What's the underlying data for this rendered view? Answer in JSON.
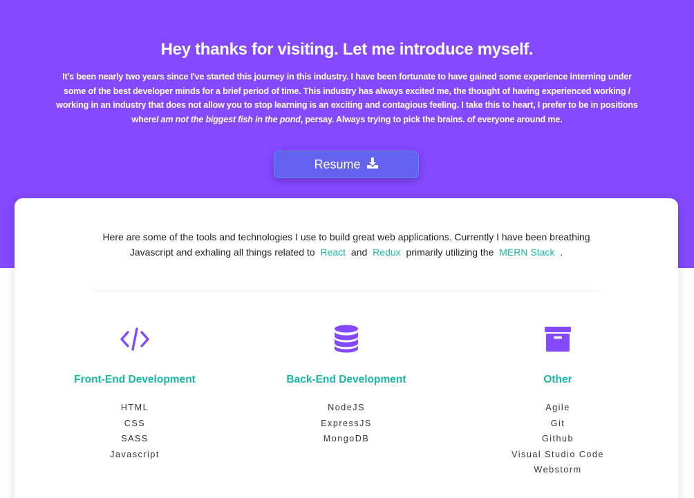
{
  "hero": {
    "title": "Hey thanks for visiting. Let me introduce myself.",
    "text_part1": "It's been nearly two years since I've started this journey in this industry. I have been fortunate to have gained some experience interning under some of the best developer minds for a brief period of time. This industry has always excited me, the thought of having experienced working / working in an industry that does not allow you to stop learning is an exciting and contagious feeling. I take this to heart, I prefer to be in positions where",
    "text_emphasis": "I am not the biggest fish in the pond",
    "text_part2": ", persay. Always trying to pick the brains. of everyone around me.",
    "resume_label": "Resume",
    "resume_icon": "download-icon"
  },
  "skills": {
    "intro_part1": "Here are some of the tools and technologies I use to build great web applications. Currently I have been breathing Javascript and exhaling all things related to",
    "link_react": "React",
    "intro_and": "and",
    "link_redux": "Redux",
    "intro_part2": "primarily utilizing the",
    "link_mern": "MERN Stack",
    "intro_end": ".",
    "columns": [
      {
        "icon": "code-icon",
        "title": "Front-End Development",
        "items": [
          "HTML",
          "CSS",
          "SASS",
          "Javascript"
        ]
      },
      {
        "icon": "database-icon",
        "title": "Back-End Development",
        "items": [
          "NodeJS",
          "ExpressJS",
          "MongoDB"
        ]
      },
      {
        "icon": "archive-icon",
        "title": "Other",
        "items": [
          "Agile",
          "Git",
          "Github",
          "Visual Studio Code",
          "Webstorm"
        ]
      }
    ]
  },
  "colors": {
    "hero_bg": "#8549ff",
    "accent": "#19b8a6",
    "button": "#6363f0"
  }
}
